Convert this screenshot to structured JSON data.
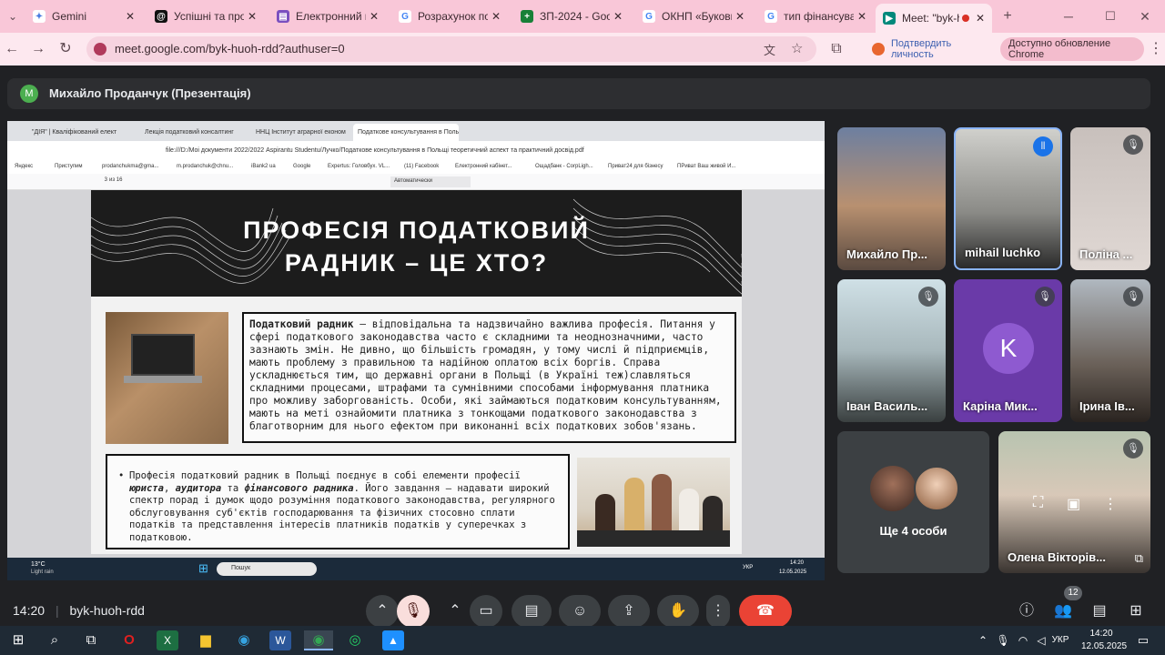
{
  "browser": {
    "tabs": [
      {
        "title": "Gemini",
        "icon": "gemini-icon",
        "color": "#4a7de0"
      },
      {
        "title": "Успішні та пров",
        "icon": "threads-icon",
        "color": "#111111"
      },
      {
        "title": "Електронний ка",
        "icon": "doc-icon",
        "color": "#7a4fbf"
      },
      {
        "title": "Розрахунок пок",
        "icon": "google-icon",
        "color": "#4285f4"
      },
      {
        "title": "ЗП-2024 - Goog",
        "icon": "sheets-icon",
        "color": "#188038"
      },
      {
        "title": "ОКНП «Буковин",
        "icon": "google-icon",
        "color": "#4285f4"
      },
      {
        "title": "тип фінансуван",
        "icon": "google-icon",
        "color": "#4285f4"
      },
      {
        "title": "Meet: \"byk-h",
        "icon": "meet-icon",
        "color": "#00897b"
      }
    ],
    "url": "meet.google.com/byk-huoh-rdd?authuser=0",
    "verify_label": "Подтвердить личность",
    "update_label": "Доступно обновление Chrome"
  },
  "presenter": {
    "initial": "M",
    "label": "Михайло Проданчук (Презентація)"
  },
  "shared_screen": {
    "tabs": [
      "\"ДІЯ\" | Кваліфікований елект",
      "Лекція податковий консалтинг",
      "ННЦ Інститут аграрної економ",
      "Податкове консультування в Польщі"
    ],
    "url": "file:///D:/Moi документи 2022/2022 Aspirantu Studentu/Лучко/Податкове консультування в Польщі теоретичний аспект та практичний досвід.pdf",
    "bookmarks": [
      "Яндекс",
      "Приступим",
      "prodanchukma@gma...",
      "m.prodanchuk@chnu...",
      "iBank2 ua",
      "Google",
      "Expertus: Головбух. VL...",
      "(11) Facebook",
      "Електронний кабінет...",
      "Ощадбанк - CorpLigh...",
      "Приват24 для бізнесу",
      "ПРиват Ваш живой И..."
    ],
    "page_current": "3",
    "page_total": "из 16",
    "zoom": "Автоматически",
    "slide": {
      "title_line1": "ПРОФЕСІЯ ПОДАТКОВИЙ",
      "title_line2": "РАДНИК – ЦЕ ХТО?",
      "p1_bold": "Податковий радник",
      "p1_text": " – відповідальна та надзвичайно важлива професія. Питання у сфері податкового законодавства часто є складними та неоднозначними, часто зазнають змін. Не дивно, що більшість громадян, у тому числі й підприємців, мають проблему з правильною та надійною оплатою всіх боргів. Справа ускладнюється тим, що державні органи в Польщі (в Україні теж)славляться складними процесами, штрафами та сумнівними способами інформування платника про можливу заборгованість. Особи, які займаються податковим консультуванням, мають на меті ознайомити платника з тонкощами податкового законодавства з благотворним для нього ефектом при виконанні всіх податкових зобов'язань.",
      "b_pre": "Професія податковий радник в Польщі поєднує в собі елементи професії ",
      "b_em1": "юриста",
      "b_mid1": ", ",
      "b_em2": "аудитора",
      "b_mid2": " та ",
      "b_em3": "фінансового радника",
      "b_post": ". Його завдання – надавати широкий спектр порад і думок щодо розуміння податкового законодавства, регулярного обслуговування суб'єктів господарювання та фізичних стосовно сплати податків та представлення інтересів платників податків у суперечках з податковою."
    },
    "taskbar": {
      "weather_temp": "13°C",
      "weather_desc": "Light rain",
      "search": "Пошук",
      "lang": "УКР",
      "time": "14:20",
      "date": "12.05.2025"
    }
  },
  "participants": [
    {
      "name": "Михайло Пр...",
      "muted": false,
      "speaking": false
    },
    {
      "name": "mihail luchko",
      "muted": false,
      "speaking": true
    },
    {
      "name": "Поліна ...",
      "muted": true
    },
    {
      "name": "Іван Василь...",
      "muted": true
    },
    {
      "name": "Каріна Мик...",
      "muted": true,
      "initial": "K",
      "color": "#7b3fc4"
    },
    {
      "name": "Ірина Ів...",
      "muted": true
    },
    {
      "name": "Олена Вікторів...",
      "muted": true
    }
  ],
  "others_label": "Ще 4 особи",
  "meeting": {
    "time": "14:20",
    "code": "byk-huoh-rdd",
    "people_count": "12"
  },
  "windows": {
    "lang": "УКР",
    "time": "14:20",
    "date": "12.05.2025"
  }
}
